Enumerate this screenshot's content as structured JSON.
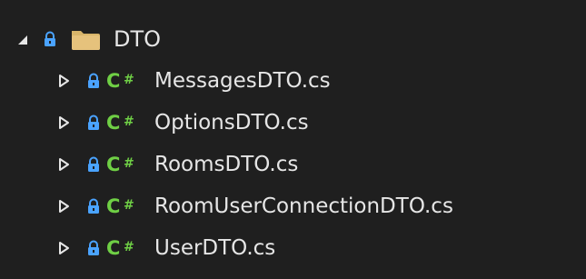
{
  "tree": {
    "partial_row": {
      "label": ""
    },
    "folder": {
      "label": "DTO",
      "expanded": true
    },
    "files": [
      {
        "label": "MessagesDTO.cs"
      },
      {
        "label": "OptionsDTO.cs"
      },
      {
        "label": "RoomsDTO.cs"
      },
      {
        "label": "RoomUserConnectionDTO.cs"
      },
      {
        "label": "UserDTO.cs"
      }
    ]
  },
  "icons": {
    "expand": "expand-triangle-icon",
    "collapse": "collapse-triangle-icon",
    "lock": "lock-icon",
    "folder": "folder-icon",
    "csharp": "csharp-file-icon"
  },
  "colors": {
    "background": "#1f1f1f",
    "text": "#e6e6e6",
    "lock": "#4aa3ff",
    "csharp": "#6fcf45",
    "folder": "#d8b56a"
  }
}
